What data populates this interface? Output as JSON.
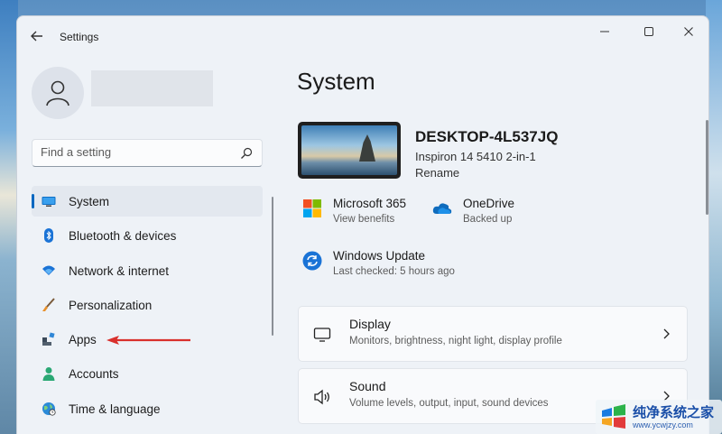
{
  "window": {
    "title": "Settings"
  },
  "search": {
    "placeholder": "Find a setting"
  },
  "sidebar": {
    "items": [
      {
        "label": "System",
        "icon": "monitor-icon",
        "selected": true
      },
      {
        "label": "Bluetooth & devices",
        "icon": "bluetooth-icon"
      },
      {
        "label": "Network & internet",
        "icon": "wifi-icon"
      },
      {
        "label": "Personalization",
        "icon": "paintbrush-icon"
      },
      {
        "label": "Apps",
        "icon": "apps-icon"
      },
      {
        "label": "Accounts",
        "icon": "person-icon"
      },
      {
        "label": "Time & language",
        "icon": "globe-clock-icon"
      }
    ]
  },
  "main": {
    "title": "System",
    "device": {
      "name": "DESKTOP-4L537JQ",
      "model": "Inspiron 14 5410 2-in-1",
      "rename": "Rename"
    },
    "status": [
      {
        "title": "Microsoft 365",
        "subtitle": "View benefits",
        "icon": "microsoft-365-icon"
      },
      {
        "title": "OneDrive",
        "subtitle": "Backed up",
        "icon": "onedrive-cloud-icon"
      },
      {
        "title": "Windows Update",
        "subtitle": "Last checked: 5 hours ago",
        "icon": "windows-update-icon"
      }
    ],
    "cards": [
      {
        "title": "Display",
        "subtitle": "Monitors, brightness, night light, display profile",
        "icon": "display-icon"
      },
      {
        "title": "Sound",
        "subtitle": "Volume levels, output, input, sound devices",
        "icon": "speaker-icon"
      }
    ]
  },
  "watermark": {
    "text": "纯净系统之家",
    "url": "www.ycwjzy.com"
  },
  "colors": {
    "accent": "#0067c0",
    "annotation_arrow": "#d9302c"
  }
}
